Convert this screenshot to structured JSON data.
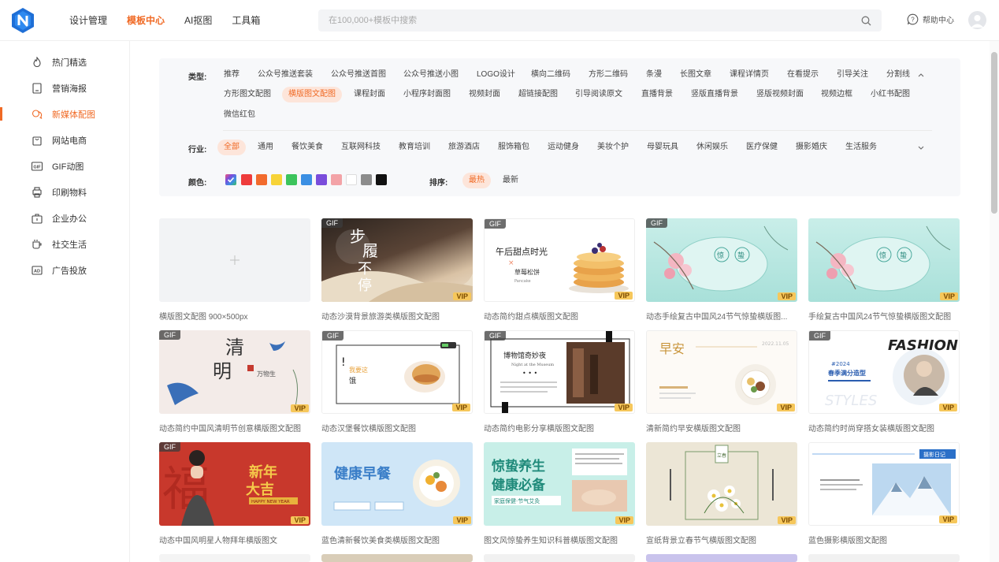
{
  "header": {
    "nav": [
      "设计管理",
      "模板中心",
      "AI抠图",
      "工具箱"
    ],
    "search_placeholder": "在100,000+模板中搜索",
    "help_label": "帮助中心"
  },
  "sidebar": {
    "items": [
      "热门精选",
      "营销海报",
      "新媒体配图",
      "网站电商",
      "GIF动图",
      "印刷物料",
      "企业办公",
      "社交生活",
      "广告投放"
    ]
  },
  "filter": {
    "type_label": "类型:",
    "type_row1": [
      "推荐",
      "公众号推送套装",
      "公众号推送首图",
      "公众号推送小图",
      "LOGO设计",
      "横向二维码",
      "方形二维码",
      "条漫",
      "长图文章",
      "课程详情页",
      "在看提示",
      "引导关注",
      "分割线"
    ],
    "type_row2": [
      "方形图文配图",
      "横版图文配图",
      "课程封面",
      "小程序封面图",
      "视频封面",
      "超链接配图",
      "引导阅读原文",
      "直播背景",
      "竖版直播背景",
      "竖版视频封面",
      "视频边框",
      "小红书配图"
    ],
    "type_row3": [
      "微信红包"
    ],
    "industry_label": "行业:",
    "industries": [
      "全部",
      "通用",
      "餐饮美食",
      "互联网科技",
      "教育培训",
      "旅游酒店",
      "服饰箱包",
      "运动健身",
      "美妆个护",
      "母婴玩具",
      "休闲娱乐",
      "医疗保健",
      "摄影婚庆",
      "生活服务"
    ],
    "color_label": "颜色:",
    "colors": [
      "#ee3c3c",
      "#f26b2d",
      "#f7d338",
      "#3cc45c",
      "#3b8fe3",
      "#7a4ddb",
      "#f3a3a7",
      "#ffffff",
      "#8c8c8c",
      "#111111"
    ],
    "sort_label": "排序:",
    "sorts": [
      "最热",
      "最新"
    ]
  },
  "cards": [
    {
      "caption": "横版图文配图 900×500px",
      "gif": "",
      "vip": ""
    },
    {
      "caption": "动态沙漠背景旅游类横版图文配图",
      "gif": "GIF",
      "vip": "VIP",
      "t1": "步",
      "t2": "履",
      "t3": "不",
      "t4": "停"
    },
    {
      "caption": "动态简约甜点横版图文配图",
      "gif": "GIF",
      "vip": "VIP",
      "t1": "午后甜点时光",
      "t2": "草莓松饼",
      "t3": "Pancake"
    },
    {
      "caption": "动态手绘复古中国风24节气惊蛰横版图...",
      "gif": "GIF",
      "vip": "VIP",
      "t1": "惊",
      "t2": "蛰"
    },
    {
      "caption": "手绘复古中国风24节气惊蛰横版图文配图",
      "gif": "",
      "vip": "VIP",
      "t1": "惊",
      "t2": "蛰"
    },
    {
      "caption": "动态简约中国风清明节创意横版图文配图",
      "gif": "GIF",
      "vip": "VIP",
      "t1": "清",
      "t2": "明",
      "t3": "万物生"
    },
    {
      "caption": "动态汉堡餐饮横版图文配图",
      "gif": "GIF",
      "vip": "VIP",
      "t1": "我要这",
      "t2": "饿"
    },
    {
      "caption": "动态简约电影分享横版图文配图",
      "gif": "GIF",
      "vip": "VIP",
      "t1": "博物馆奇妙夜",
      "t2": "Night at the Museum"
    },
    {
      "caption": "清新简约早安横版图文配图",
      "gif": "",
      "vip": "VIP",
      "t1": "早安",
      "t2": "2022.11.05"
    },
    {
      "caption": "动态简约时尚穿搭女装横版图文配图",
      "gif": "GIF",
      "vip": "VIP",
      "t1": "FASHION",
      "t2": "春季满分造型",
      "t3": "STYLES"
    },
    {
      "caption": "动态中国风明星人物拜年横版图文",
      "gif": "GIF",
      "vip": "VIP",
      "t1": "新年",
      "t2": "大吉",
      "t3": "HAPPY NEW YEAR"
    },
    {
      "caption": "蓝色清新餐饮美食类横版图文配图",
      "gif": "",
      "vip": "VIP",
      "t1": "健康早餐"
    },
    {
      "caption": "图文风惊蛰养生知识科普横版图文配图",
      "gif": "",
      "vip": "VIP",
      "t1": "惊蛰养生",
      "t2": "健康必备",
      "t3": "家庭保健·节气艾灸"
    },
    {
      "caption": "宣纸背景立春节气横版图文配图",
      "gif": "",
      "vip": "VIP",
      "t1": "立春"
    },
    {
      "caption": "蓝色摄影横版图文配图",
      "gif": "",
      "vip": "VIP",
      "t1": "摄影日记"
    }
  ]
}
